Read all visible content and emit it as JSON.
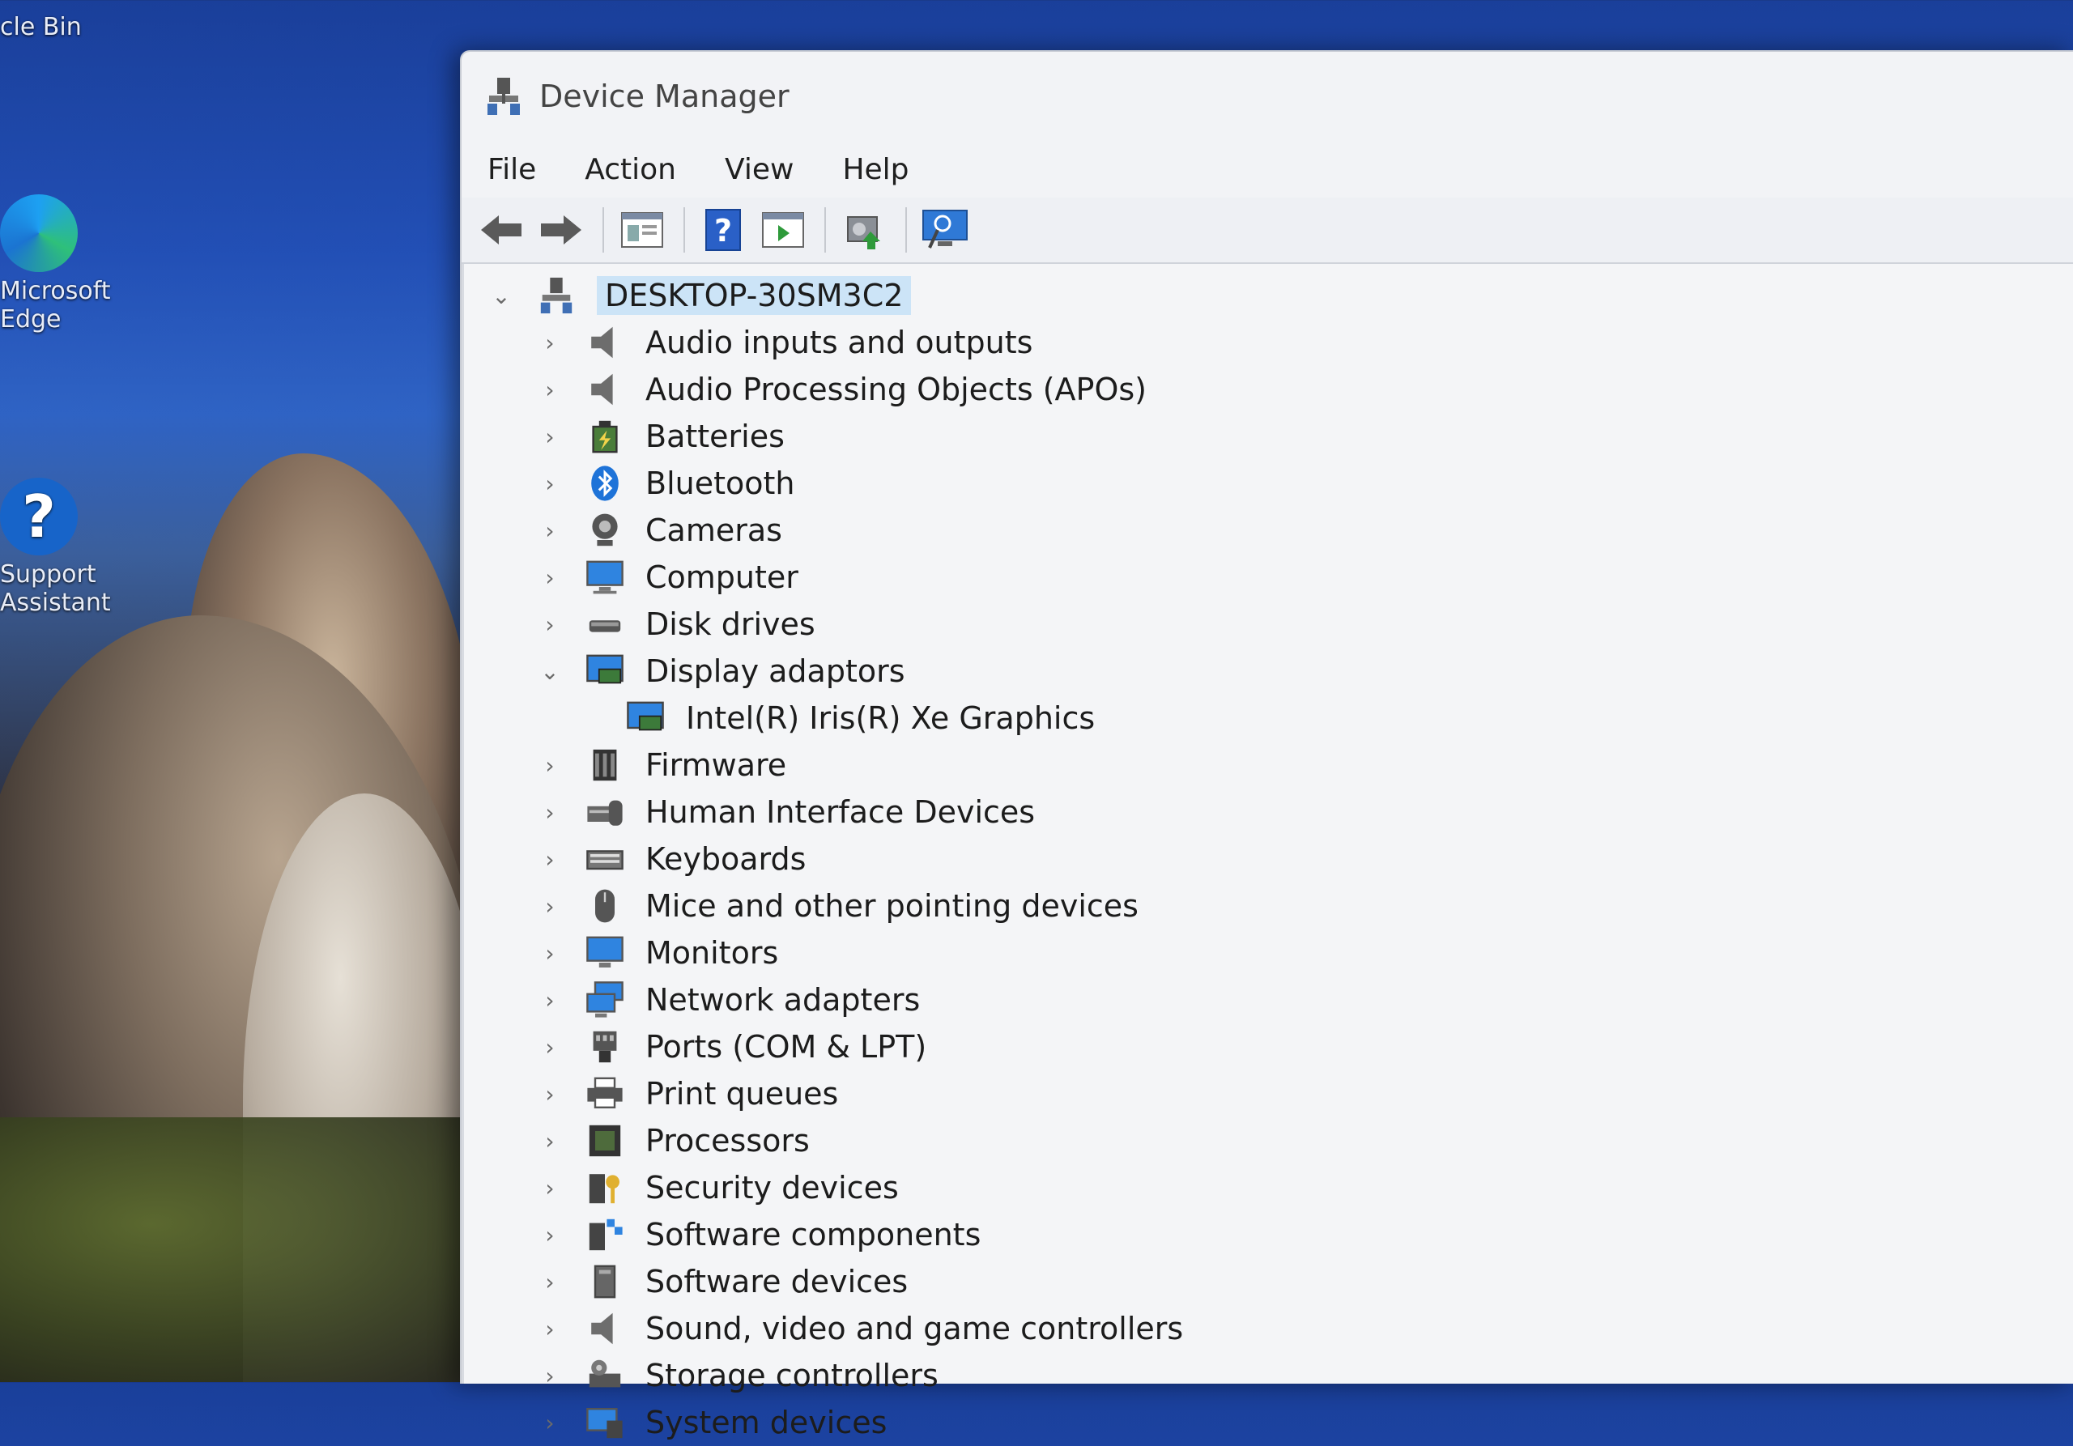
{
  "desktop": {
    "icons": [
      {
        "label": "cle Bin",
        "icon": "recycle-bin-icon"
      },
      {
        "label": "Microsoft Edge",
        "icon": "edge-icon"
      },
      {
        "label": "Support Assistant",
        "icon": "help-icon"
      }
    ]
  },
  "window": {
    "title": "Device Manager",
    "menu": [
      "File",
      "Action",
      "View",
      "Help"
    ],
    "toolbar": [
      "back-icon",
      "forward-icon",
      "properties-icon",
      "help-icon",
      "run-icon",
      "update-driver-icon",
      "scan-hardware-icon"
    ]
  },
  "tree": {
    "root": "DESKTOP-30SM3C2",
    "categories": [
      {
        "label": "Audio inputs and outputs",
        "icon": "speaker-icon",
        "expanded": false
      },
      {
        "label": "Audio Processing Objects (APOs)",
        "icon": "speaker-icon",
        "expanded": false
      },
      {
        "label": "Batteries",
        "icon": "battery-icon",
        "expanded": false
      },
      {
        "label": "Bluetooth",
        "icon": "bluetooth-icon",
        "expanded": false
      },
      {
        "label": "Cameras",
        "icon": "camera-icon",
        "expanded": false
      },
      {
        "label": "Computer",
        "icon": "computer-icon",
        "expanded": false
      },
      {
        "label": "Disk drives",
        "icon": "disk-drive-icon",
        "expanded": false
      },
      {
        "label": "Display adaptors",
        "icon": "display-adapter-icon",
        "expanded": true,
        "children": [
          {
            "label": "Intel(R) Iris(R) Xe Graphics",
            "icon": "display-adapter-icon"
          }
        ]
      },
      {
        "label": "Firmware",
        "icon": "firmware-icon",
        "expanded": false
      },
      {
        "label": "Human Interface Devices",
        "icon": "hid-icon",
        "expanded": false
      },
      {
        "label": "Keyboards",
        "icon": "keyboard-icon",
        "expanded": false
      },
      {
        "label": "Mice and other pointing devices",
        "icon": "mouse-icon",
        "expanded": false
      },
      {
        "label": "Monitors",
        "icon": "monitor-icon",
        "expanded": false
      },
      {
        "label": "Network adapters",
        "icon": "network-icon",
        "expanded": false
      },
      {
        "label": "Ports (COM & LPT)",
        "icon": "port-icon",
        "expanded": false
      },
      {
        "label": "Print queues",
        "icon": "printer-icon",
        "expanded": false
      },
      {
        "label": "Processors",
        "icon": "processor-icon",
        "expanded": false
      },
      {
        "label": "Security devices",
        "icon": "security-icon",
        "expanded": false
      },
      {
        "label": "Software components",
        "icon": "software-component-icon",
        "expanded": false
      },
      {
        "label": "Software devices",
        "icon": "software-device-icon",
        "expanded": false
      },
      {
        "label": "Sound, video and game controllers",
        "icon": "speaker-icon",
        "expanded": false
      },
      {
        "label": "Storage controllers",
        "icon": "storage-icon",
        "expanded": false
      },
      {
        "label": "System devices",
        "icon": "system-icon",
        "expanded": false
      }
    ]
  },
  "colors": {
    "selection": "#cce4f7",
    "accent": "#1a73e8"
  }
}
